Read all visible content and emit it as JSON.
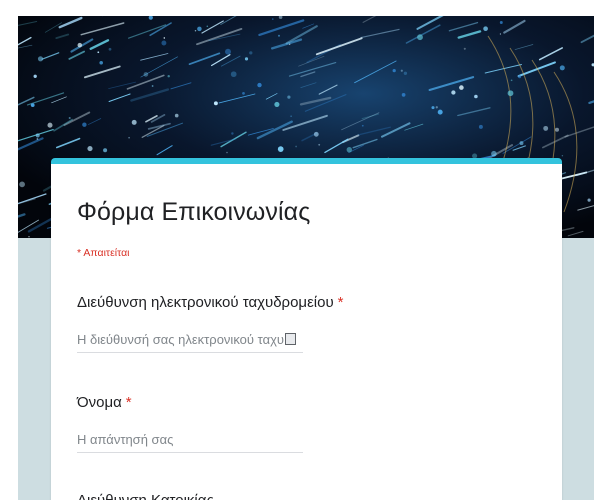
{
  "form": {
    "title": "Φόρμα Επικοινωνίας",
    "required_note": "* Απαιτείται",
    "accent_color": "#33c3dd",
    "background_color": "#cddde1",
    "questions": [
      {
        "label": "Διεύθυνση ηλεκτρονικού ταχυδρομείου",
        "required_mark": "*",
        "placeholder": "Η διεύθυνσή σας ηλεκτρονικού ταχυ"
      },
      {
        "label": "Όνομα",
        "required_mark": "*",
        "placeholder": "Η απάντησή σας"
      },
      {
        "label": "Διεύθυνση Κατοικίας"
      }
    ]
  },
  "banner": {
    "icon": "fiber-optic-header-image"
  }
}
